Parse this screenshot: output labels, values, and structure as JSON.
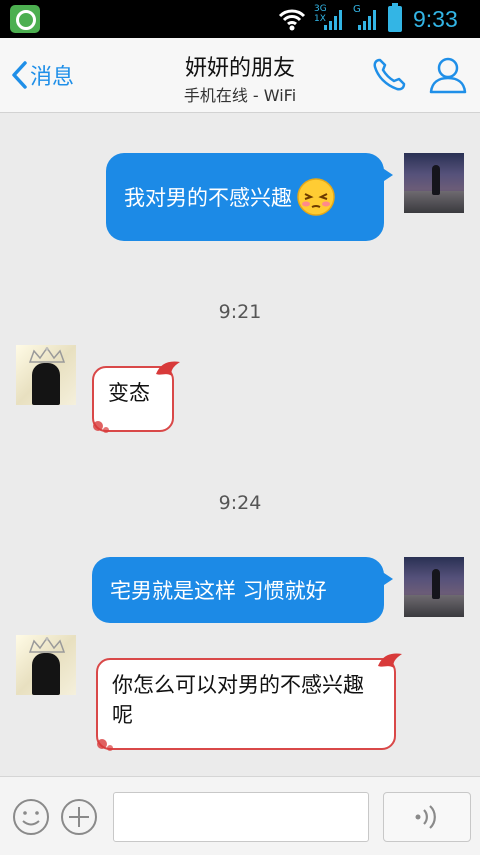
{
  "status_bar": {
    "time": "9:33",
    "network_top": "3G",
    "network_bottom": "1X",
    "network_g": "G",
    "icons": [
      "app-icon",
      "wifi-icon",
      "signal-icon",
      "signal-icon",
      "battery-icon"
    ],
    "accent": "#33b5e5"
  },
  "header": {
    "back_label": "消息",
    "title": "妍妍的朋友",
    "subtitle": "手机在线 - WiFi",
    "accent": "#1f8fe8"
  },
  "messages": [
    {
      "side": "out",
      "text": "我对男的不感兴趣",
      "emoji": "shy-face-icon"
    },
    {
      "type": "time",
      "text": "9:21"
    },
    {
      "side": "in",
      "text": "变态"
    },
    {
      "type": "time",
      "text": "9:24"
    },
    {
      "side": "out",
      "text": "宅男就是这样 习惯就好"
    },
    {
      "side": "in",
      "text": "你怎么可以对男的不感兴趣呢"
    }
  ],
  "input_bar": {
    "placeholder": "",
    "value": ""
  },
  "colors": {
    "outgoing_bubble": "#1c8ae6",
    "incoming_border": "#d94848",
    "chat_background": "#ebebeb"
  }
}
